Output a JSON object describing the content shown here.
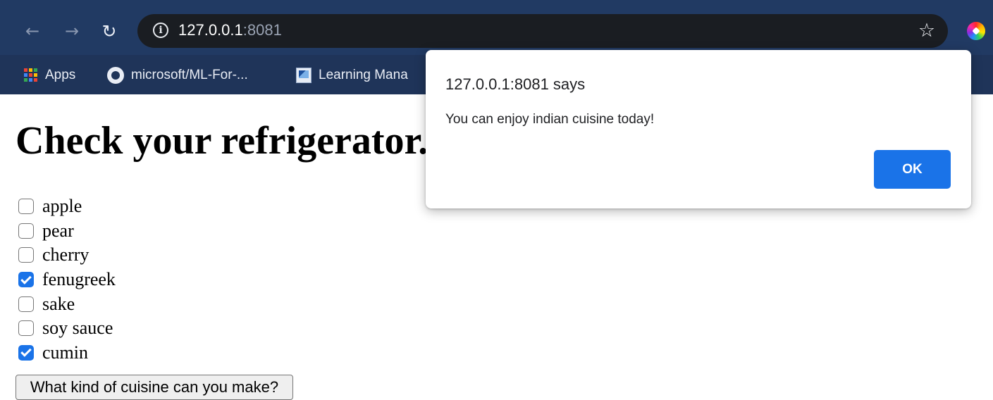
{
  "browser": {
    "back_icon": "arrow-left-icon",
    "forward_icon": "arrow-right-icon",
    "reload_icon": "reload-icon",
    "info_icon": "info-icon",
    "url_host": "127.0.0.1",
    "url_port": ":8081",
    "bookmark_star_icon": "star-icon",
    "extension_icon": "color-wheel-icon",
    "toolbar_color": "#213a63",
    "omnibox_color": "#1a1d22"
  },
  "bookmarks": [
    {
      "label": "Apps",
      "icon": "apps-grid-icon"
    },
    {
      "label": "microsoft/ML-For-...",
      "icon": "github-icon"
    },
    {
      "label": "Learning Mana",
      "icon": "learning-management-icon"
    }
  ],
  "page": {
    "title": "Check your refrigerator.",
    "ingredients": [
      {
        "label": "apple",
        "checked": false
      },
      {
        "label": "pear",
        "checked": false
      },
      {
        "label": "cherry",
        "checked": false
      },
      {
        "label": "fenugreek",
        "checked": true
      },
      {
        "label": "sake",
        "checked": false
      },
      {
        "label": "soy sauce",
        "checked": false
      },
      {
        "label": "cumin",
        "checked": true
      }
    ],
    "submit_label": "What kind of cuisine can you make?"
  },
  "dialog": {
    "title": "127.0.0.1:8081 says",
    "message": "You can enjoy indian cuisine today!",
    "ok_label": "OK",
    "ok_color": "#1a73e8"
  }
}
